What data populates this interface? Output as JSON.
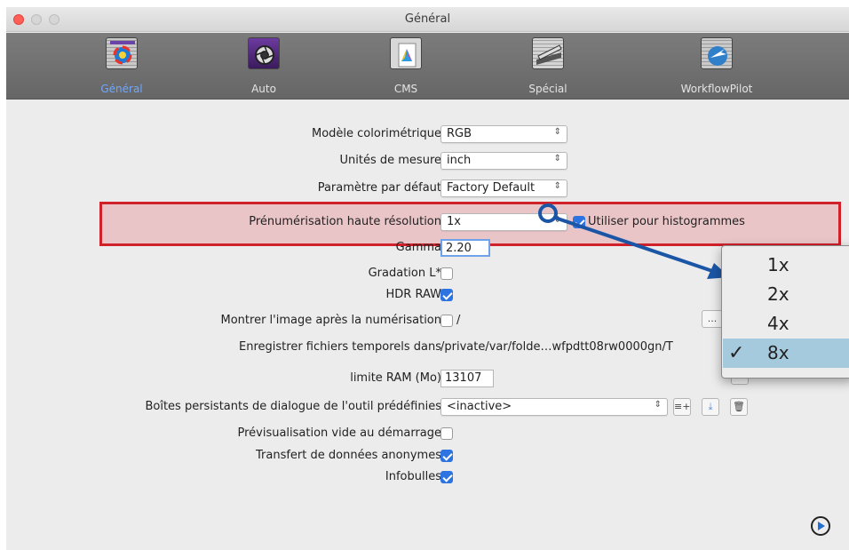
{
  "window": {
    "title": "Général"
  },
  "colors": {
    "accent": "#2e74e0",
    "highlight_border": "#d0202a",
    "annotation": "#1b56a6",
    "active_tab": "#6ea7ff"
  },
  "toolbar": {
    "tabs": [
      {
        "label": "Général",
        "icon": "general-icon",
        "active": true
      },
      {
        "label": "Auto",
        "icon": "aperture-icon",
        "active": false
      },
      {
        "label": "CMS",
        "icon": "cms-icon",
        "active": false
      },
      {
        "label": "Spécial",
        "icon": "scanner-icon",
        "active": false
      },
      {
        "label": "WorkflowPilot",
        "icon": "workflow-pilot-icon",
        "active": false
      }
    ]
  },
  "settings": {
    "color_model": {
      "label": "Modèle colorimétrique",
      "value": "RGB"
    },
    "units": {
      "label": "Unités de mesure",
      "value": "inch"
    },
    "default_param": {
      "label": "Paramètre par défaut",
      "value": "Factory Default"
    },
    "prescan": {
      "label": "Prénumérisation haute résolution",
      "value": "1x",
      "histogram_label": "Utiliser pour histogrammes",
      "histogram_checked": true
    },
    "gamma": {
      "label": "Gamma",
      "value": "2.20"
    },
    "gradation": {
      "label": "Gradation L*",
      "checked": false
    },
    "hdr": {
      "label": "HDR RAW",
      "checked": true
    },
    "show_after": {
      "label": "Montrer l'image après la numérisation",
      "checked": false,
      "path": "/",
      "browse": "..."
    },
    "temp": {
      "label": "Enregistrer fichiers temporels dans",
      "path": "/private/var/folde…wfpdtt08rw0000gn/T"
    },
    "ram": {
      "label": "limite RAM (Mo)",
      "value": "13107"
    },
    "dialogs": {
      "label": "Boîtes persistants de dialogue de l'outil prédéfinies",
      "value": "<inactive>"
    },
    "empty_preview": {
      "label": "Prévisualisation vide au démarrage",
      "checked": false
    },
    "anon": {
      "label": "Transfert de données anonymes",
      "checked": true
    },
    "tooltips": {
      "label": "Infobulles",
      "checked": true
    }
  },
  "popup": {
    "options": [
      "1x",
      "2x",
      "4x",
      "8x"
    ],
    "selected": "8x"
  }
}
